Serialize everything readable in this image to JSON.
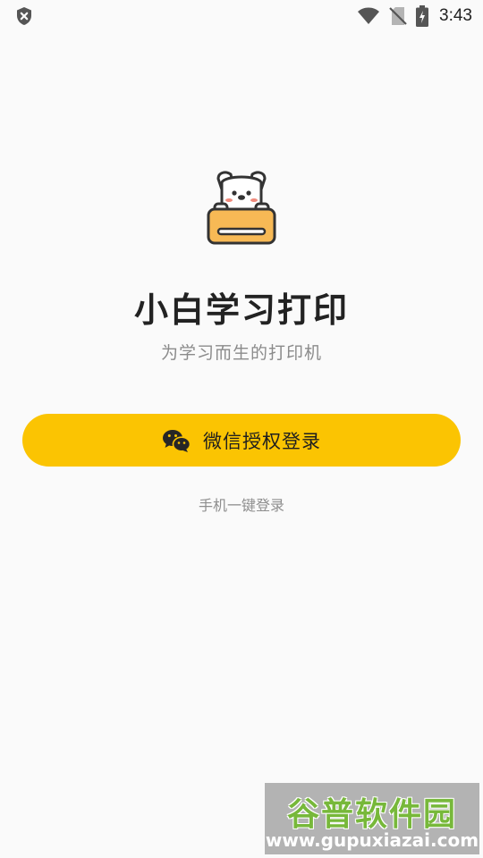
{
  "status_bar": {
    "time": "3:43",
    "icons": [
      "shield-x-icon",
      "wifi-icon",
      "no-sim-icon",
      "battery-charging-icon"
    ]
  },
  "app": {
    "title": "小白学习打印",
    "subtitle": "为学习而生的打印机",
    "logo_icon": "dog-printer-logo"
  },
  "login": {
    "wechat_label": "微信授权登录",
    "wechat_icon": "wechat-icon",
    "phone_label": "手机一键登录"
  },
  "watermark": {
    "title": "谷普软件园",
    "url": "www.gupuxiazai.com"
  },
  "colors": {
    "background": "#fafafa",
    "accent": "#fbc402",
    "title": "#222222",
    "subtitle": "#8b8b8b",
    "watermark_green": "#77b83a"
  }
}
